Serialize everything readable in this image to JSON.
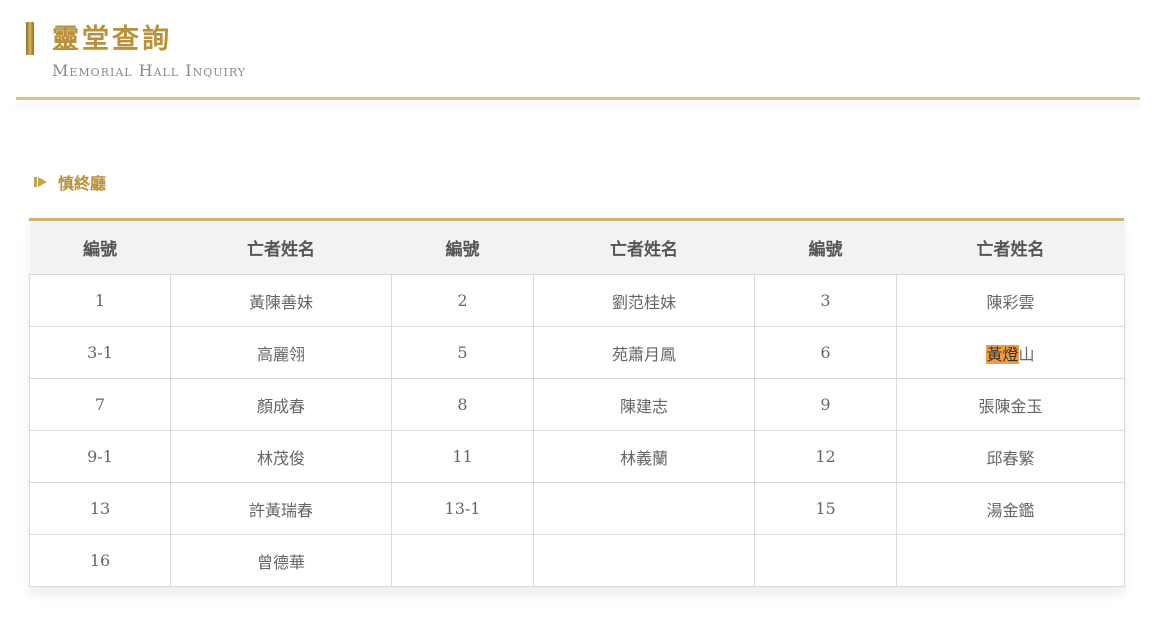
{
  "page": {
    "title_zh": "靈堂查詢",
    "title_en": "Memorial Hall Inquiry"
  },
  "section": {
    "label": "慎終廳"
  },
  "table": {
    "headers": [
      "編號",
      "亡者姓名",
      "編號",
      "亡者姓名",
      "編號",
      "亡者姓名"
    ],
    "rows": [
      [
        {
          "no": "1",
          "name": "黃陳善妹"
        },
        {
          "no": "2",
          "name": "劉范桂妹"
        },
        {
          "no": "3",
          "name": "陳彩雲"
        }
      ],
      [
        {
          "no": "3-1",
          "name": "高麗翎"
        },
        {
          "no": "5",
          "name": "苑蕭月鳳"
        },
        {
          "no": "6",
          "name_highlight": "黃燈",
          "name_rest": "山"
        }
      ],
      [
        {
          "no": "7",
          "name": "顏成春"
        },
        {
          "no": "8",
          "name": "陳建志"
        },
        {
          "no": "9",
          "name": "張陳金玉"
        }
      ],
      [
        {
          "no": "9-1",
          "name": "林茂俊"
        },
        {
          "no": "11",
          "name": "林義蘭"
        },
        {
          "no": "12",
          "name": "邱春繁"
        }
      ],
      [
        {
          "no": "13",
          "name": "許黃瑞春"
        },
        {
          "no": "13-1",
          "name": ""
        },
        {
          "no": "15",
          "name": "湯金鑑"
        }
      ],
      [
        {
          "no": "16",
          "name": "曾德華"
        },
        {
          "no": "",
          "name": ""
        },
        {
          "no": "",
          "name": ""
        }
      ]
    ]
  },
  "colors": {
    "accent_gold": "#b8913a",
    "highlight": "#f29a3f"
  }
}
